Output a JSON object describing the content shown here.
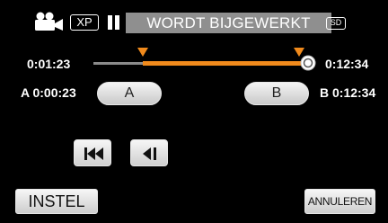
{
  "status_bar": {
    "mode_icon": "video-camera-icon",
    "quality_badge": "XP",
    "pause_icon": "pause-icon",
    "status_message": "WORDT BIJGEWERKT",
    "media_badge": "SD"
  },
  "timeline": {
    "current_time": "0:01:23",
    "end_time": "0:12:34",
    "track_color": "#f08a1c",
    "marker_color": "#f08a1c",
    "handle_icon": "slider-handle-icon"
  },
  "ab_points": {
    "a_label": "A 0:00:23",
    "a_button": "A",
    "b_label": "B 0:12:34",
    "b_button": "B"
  },
  "transport": {
    "skip_back_icon": "skip-to-start-icon",
    "step_back_icon": "frame-step-back-icon"
  },
  "actions": {
    "set_label": "INSTEL",
    "cancel_label": "ANNULEREN"
  }
}
